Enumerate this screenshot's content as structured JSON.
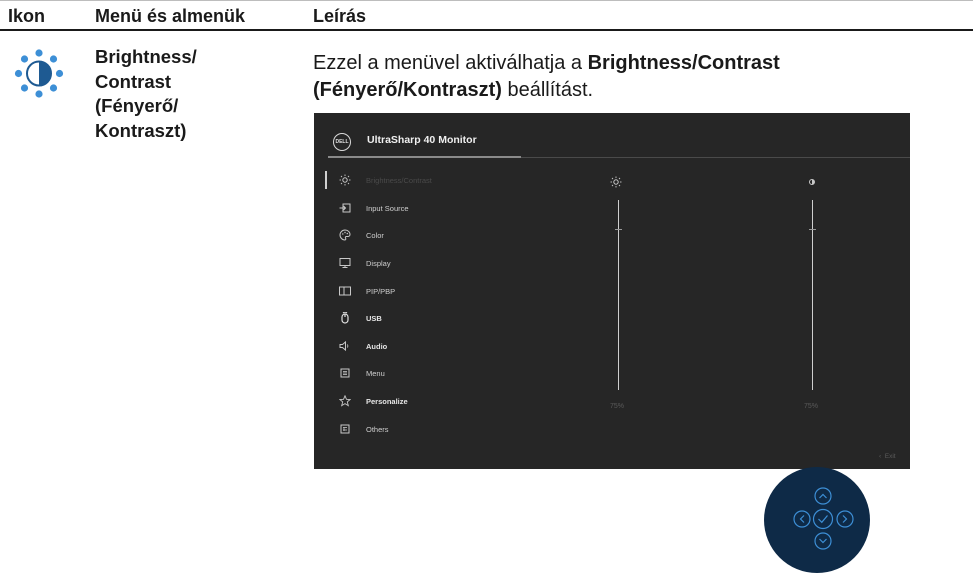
{
  "table": {
    "headers": {
      "icon": "Ikon",
      "menu": "Menü és almenük",
      "desc": "Leírás"
    }
  },
  "row": {
    "icon_name": "brightness-icon",
    "menu_lines": [
      "Brightness/",
      "Contrast",
      "(Fényerő/",
      "Kontraszt)"
    ],
    "desc_before": "Ezzel a menüvel aktiválhatja a ",
    "desc_bold": "Brightness/Contrast (Fényerő/Kontraszt)",
    "desc_after": " beállítást."
  },
  "osd": {
    "logo_text": "DELL",
    "title": "UltraSharp 40 Monitor",
    "menu_items": [
      {
        "label": "Brightness/Contrast",
        "icon": "sun-icon",
        "active": true,
        "bold": false
      },
      {
        "label": "Input Source",
        "icon": "input-source-icon",
        "active": false,
        "bold": false
      },
      {
        "label": "Color",
        "icon": "palette-icon",
        "active": false,
        "bold": false
      },
      {
        "label": "Display",
        "icon": "display-icon",
        "active": false,
        "bold": false
      },
      {
        "label": "PIP/PBP",
        "icon": "pip-icon",
        "active": false,
        "bold": false
      },
      {
        "label": "USB",
        "icon": "mouse-icon",
        "active": false,
        "bold": true
      },
      {
        "label": "Audio",
        "icon": "speaker-icon",
        "active": false,
        "bold": true
      },
      {
        "label": "Menu",
        "icon": "menu-icon",
        "active": false,
        "bold": false
      },
      {
        "label": "Personalize",
        "icon": "star-icon",
        "active": false,
        "bold": true
      },
      {
        "label": "Others",
        "icon": "others-icon",
        "active": false,
        "bold": false
      }
    ],
    "brightness_value": "75%",
    "contrast_value": "75%",
    "brightness_level": 0.75,
    "contrast_level": 0.75,
    "exit_label": "Exit"
  },
  "joystick": {
    "buttons": [
      "up",
      "left",
      "ok",
      "right",
      "down"
    ]
  },
  "colors": {
    "accent_blue": "#3d8fd6",
    "joystick_bg": "#0e2a47",
    "osd_bg": "#262626"
  }
}
